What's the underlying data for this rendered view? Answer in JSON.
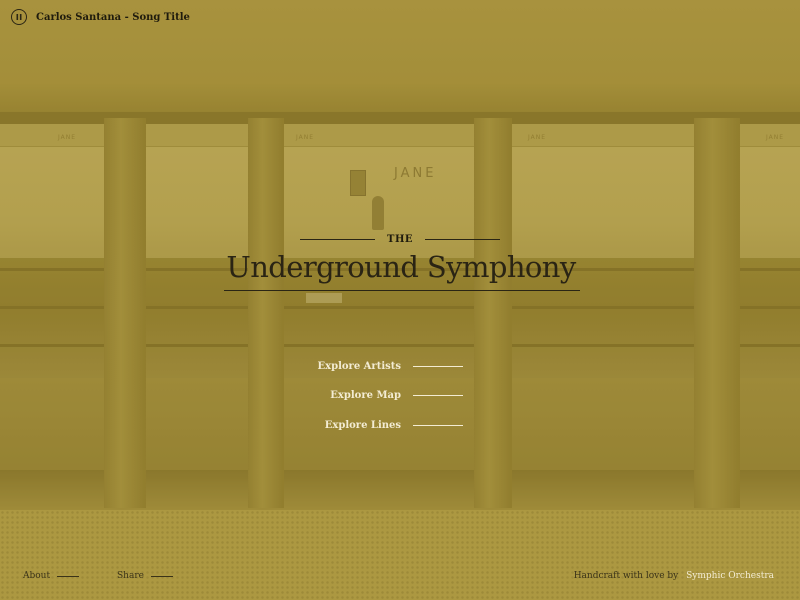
{
  "player": {
    "track": "Carlos Santana - Song Title",
    "state_icon": "pause-icon"
  },
  "scene": {
    "station_signs": [
      "JANE",
      "JANE",
      "JANE",
      "JANE"
    ],
    "station_name": "JANE"
  },
  "hero": {
    "kicker": "THE",
    "title": "Underground Symphony"
  },
  "menu": {
    "items": [
      {
        "label": "Explore Artists"
      },
      {
        "label": "Explore Map"
      },
      {
        "label": "Explore Lines"
      }
    ]
  },
  "footer": {
    "about": "About",
    "share": "Share",
    "credit_text": "Handcraft with love by",
    "credit_link": "Symphic Orchestra"
  },
  "colors": {
    "overlay": "#a8943f",
    "dark_text": "#1f1b0d",
    "light_text": "#f3ecd3"
  }
}
